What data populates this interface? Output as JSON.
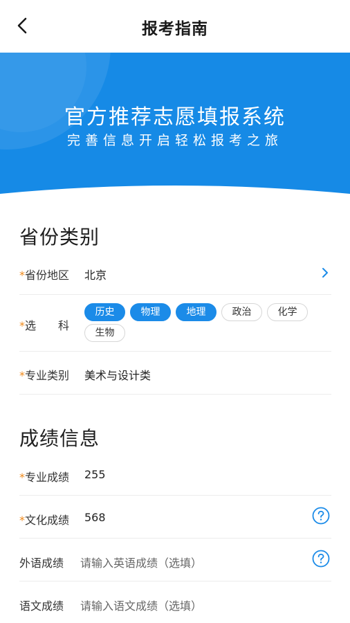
{
  "header": {
    "title": "报考指南"
  },
  "banner": {
    "title": "官方推荐志愿填报系统",
    "subtitle": "完善信息开启轻松报考之旅"
  },
  "sections": {
    "province": {
      "title": "省份类别"
    },
    "score": {
      "title": "成绩信息"
    }
  },
  "fields": {
    "province": {
      "label": "省份地区",
      "value": "北京"
    },
    "subjects": {
      "label": "选　　科",
      "options": [
        {
          "label": "历史",
          "selected": true
        },
        {
          "label": "物理",
          "selected": true
        },
        {
          "label": "地理",
          "selected": true
        },
        {
          "label": "政治",
          "selected": false
        },
        {
          "label": "化学",
          "selected": false
        },
        {
          "label": "生物",
          "selected": false
        }
      ]
    },
    "major_category": {
      "label": "专业类别",
      "value": "美术与设计类"
    },
    "major_score": {
      "label": "专业成绩",
      "value": "255"
    },
    "culture_score": {
      "label": "文化成绩",
      "value": "568"
    },
    "english_score": {
      "label": "外语成绩",
      "placeholder": "请输入英语成绩（选填）"
    },
    "chinese_score": {
      "label": "语文成绩",
      "placeholder": "请输入语文成绩（选填）"
    }
  },
  "colors": {
    "accent": "#1b8be8",
    "required_star": "#f08a1c",
    "banner": "#168ae6"
  },
  "icons": {
    "back": "chevron-left-icon",
    "arrow": "chevron-right-icon",
    "help": "question-circle-icon"
  }
}
